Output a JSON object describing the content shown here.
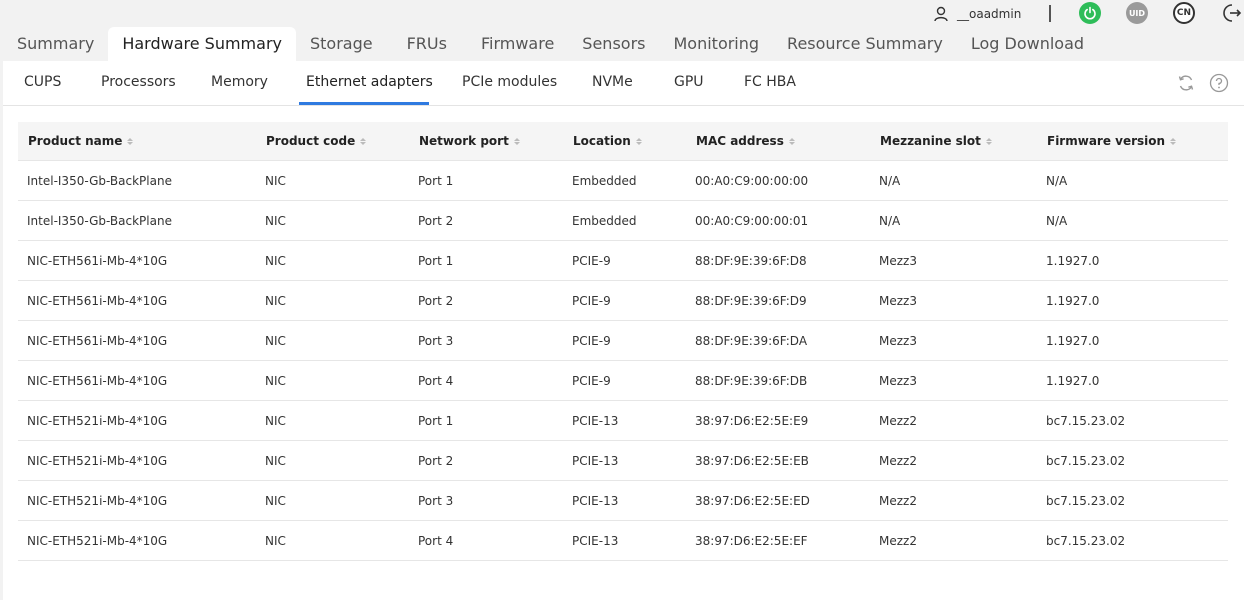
{
  "header": {
    "username": "__oaadmin",
    "uid_label": "UID",
    "lang_label": "CN"
  },
  "main_tabs": [
    {
      "label": "Summary"
    },
    {
      "label": "Hardware Summary"
    },
    {
      "label": "Storage"
    },
    {
      "label": "FRUs"
    },
    {
      "label": "Firmware"
    },
    {
      "label": "Sensors"
    },
    {
      "label": "Monitoring"
    },
    {
      "label": "Resource Summary"
    },
    {
      "label": "Log Download"
    }
  ],
  "active_main_tab": "Hardware Summary",
  "sub_tabs": [
    {
      "label": "CUPS"
    },
    {
      "label": "Processors"
    },
    {
      "label": "Memory"
    },
    {
      "label": "Ethernet adapters"
    },
    {
      "label": "PCIe modules"
    },
    {
      "label": "NVMe"
    },
    {
      "label": "GPU"
    },
    {
      "label": "FC HBA"
    }
  ],
  "active_sub_tab": "Ethernet adapters",
  "table": {
    "columns": [
      "Product name",
      "Product code",
      "Network port",
      "Location",
      "MAC address",
      "Mezzanine slot",
      "Firmware version"
    ],
    "rows": [
      [
        "Intel-I350-Gb-BackPlane",
        "NIC",
        "Port 1",
        "Embedded",
        "00:A0:C9:00:00:00",
        "N/A",
        "N/A"
      ],
      [
        "Intel-I350-Gb-BackPlane",
        "NIC",
        "Port 2",
        "Embedded",
        "00:A0:C9:00:00:01",
        "N/A",
        "N/A"
      ],
      [
        "NIC-ETH561i-Mb-4*10G",
        "NIC",
        "Port 1",
        "PCIE-9",
        "88:DF:9E:39:6F:D8",
        "Mezz3",
        "1.1927.0"
      ],
      [
        "NIC-ETH561i-Mb-4*10G",
        "NIC",
        "Port 2",
        "PCIE-9",
        "88:DF:9E:39:6F:D9",
        "Mezz3",
        "1.1927.0"
      ],
      [
        "NIC-ETH561i-Mb-4*10G",
        "NIC",
        "Port 3",
        "PCIE-9",
        "88:DF:9E:39:6F:DA",
        "Mezz3",
        "1.1927.0"
      ],
      [
        "NIC-ETH561i-Mb-4*10G",
        "NIC",
        "Port 4",
        "PCIE-9",
        "88:DF:9E:39:6F:DB",
        "Mezz3",
        "1.1927.0"
      ],
      [
        "NIC-ETH521i-Mb-4*10G",
        "NIC",
        "Port 1",
        "PCIE-13",
        "38:97:D6:E2:5E:E9",
        "Mezz2",
        "bc7.15.23.02"
      ],
      [
        "NIC-ETH521i-Mb-4*10G",
        "NIC",
        "Port 2",
        "PCIE-13",
        "38:97:D6:E2:5E:EB",
        "Mezz2",
        "bc7.15.23.02"
      ],
      [
        "NIC-ETH521i-Mb-4*10G",
        "NIC",
        "Port 3",
        "PCIE-13",
        "38:97:D6:E2:5E:ED",
        "Mezz2",
        "bc7.15.23.02"
      ],
      [
        "NIC-ETH521i-Mb-4*10G",
        "NIC",
        "Port 4",
        "PCIE-13",
        "38:97:D6:E2:5E:EF",
        "Mezz2",
        "bc7.15.23.02"
      ]
    ]
  },
  "icons": {
    "user": "user-icon",
    "power": "power-icon",
    "uid": "uid-icon",
    "language": "language-icon",
    "logout": "logout-icon",
    "refresh": "refresh-icon",
    "help": "help-icon"
  },
  "colors": {
    "accent": "#2f7ae0",
    "power_on": "#2ebd59",
    "uid_gray": "#9a9a9a",
    "background": "#f2f2f2"
  }
}
